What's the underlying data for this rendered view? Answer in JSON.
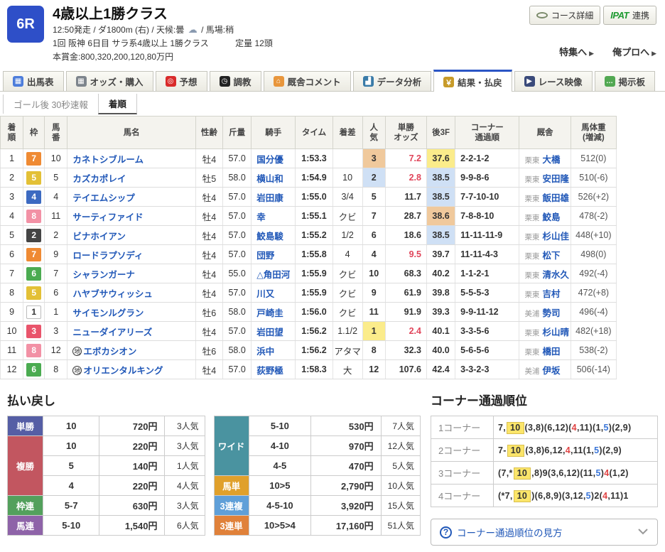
{
  "header": {
    "race_number": "6R",
    "title": "4歳以上1勝クラス",
    "meta1_left": "12:50発走 / ダ1800m (右) / 天候:曇",
    "weather_glyph": "☁",
    "meta1_right": "/ 馬場:稍",
    "meta2_left": "1回 阪神 6日目 サラ系4歳以上 1勝クラス",
    "meta2_right": "定量 12頭",
    "meta3": "本賞金:800,320,200,120,80万円",
    "course_button": "コース詳細",
    "ipat_logo": "IPAT",
    "ipat_button": "連携",
    "links": [
      {
        "label": "特集へ",
        "arrow": "▶"
      },
      {
        "label": "俺プロへ",
        "arrow": "▶"
      }
    ]
  },
  "tabs": [
    {
      "label": "出馬表",
      "icon": "entry-table",
      "glyph": "▦",
      "color": "#4d7ddb",
      "active": false
    },
    {
      "label": "オッズ・購入",
      "icon": "odds-purchase",
      "glyph": "▦",
      "color": "#7d848c",
      "active": false
    },
    {
      "label": "予想",
      "icon": "prediction-target",
      "glyph": "◎",
      "color": "#d92b2b",
      "active": false
    },
    {
      "label": "調教",
      "icon": "training-stopwatch",
      "glyph": "◷",
      "color": "#222222",
      "active": false
    },
    {
      "label": "厩舎コメント",
      "icon": "stable-comment",
      "glyph": "⌂",
      "color": "#e8963c",
      "active": false
    },
    {
      "label": "データ分析",
      "icon": "data-analysis",
      "glyph": "▟",
      "color": "#3a7ba8",
      "active": false
    },
    {
      "label": "結果・払戻",
      "icon": "result-payout",
      "glyph": "￥",
      "color": "#c79b2a",
      "active": true
    },
    {
      "label": "レース映像",
      "icon": "race-video",
      "glyph": "▶",
      "color": "#3a4a7a",
      "active": false
    },
    {
      "label": "掲示板",
      "icon": "bbs-chat",
      "glyph": "…",
      "color": "#52a852",
      "active": false
    }
  ],
  "subtabs": [
    {
      "label": "ゴール後 30秒速報",
      "active": false
    },
    {
      "label": "着順",
      "active": true
    }
  ],
  "results": {
    "columns": [
      "着\n順",
      "枠",
      "馬\n番",
      "馬名",
      "性齢",
      "斤量",
      "騎手",
      "タイム",
      "着差",
      "人\n気",
      "単勝\nオッズ",
      "後3F",
      "コーナー\n通過順",
      "厩舎",
      "馬体重\n(増減)"
    ],
    "waku_colors": {
      "1": "#ffffff",
      "2": "#444444",
      "3": "#e9546b",
      "4": "#3c6ac1",
      "5": "#e3c036",
      "6": "#4bab51",
      "7": "#ef8a33",
      "8": "#f291a5"
    },
    "rows": [
      {
        "rank": "1",
        "waku": "7",
        "num": "10",
        "mark": "",
        "name": "カネトシブルーム",
        "sexage": "牡4",
        "load": "57.0",
        "jockey": "国分優",
        "time": "1:53.3",
        "margin": "",
        "pop": "3",
        "pop_hl": 3,
        "odds": "7.2",
        "odds_red": true,
        "l3f": "37.6",
        "l3f_hl": 1,
        "corner": "2-2-1-2",
        "region": "栗東",
        "trainer": "大橋",
        "weight": "512(0)"
      },
      {
        "rank": "2",
        "waku": "5",
        "num": "5",
        "mark": "",
        "name": "カズカポレイ",
        "sexage": "牡5",
        "load": "58.0",
        "jockey": "横山和",
        "time": "1:54.9",
        "margin": "10",
        "pop": "2",
        "pop_hl": 2,
        "odds": "2.8",
        "odds_red": true,
        "l3f": "38.5",
        "l3f_hl": 2,
        "corner": "9-9-8-6",
        "region": "栗東",
        "trainer": "安田隆",
        "weight": "510(-6)"
      },
      {
        "rank": "3",
        "waku": "4",
        "num": "4",
        "mark": "",
        "name": "テイエムシップ",
        "sexage": "牡4",
        "load": "57.0",
        "jockey": "岩田康",
        "time": "1:55.0",
        "margin": "3/4",
        "pop": "5",
        "pop_hl": 0,
        "odds": "11.7",
        "odds_red": false,
        "l3f": "38.5",
        "l3f_hl": 2,
        "corner": "7-7-10-10",
        "region": "栗東",
        "trainer": "飯田雄",
        "weight": "526(+2)"
      },
      {
        "rank": "4",
        "waku": "8",
        "num": "11",
        "mark": "",
        "name": "サーティファイド",
        "sexage": "牡4",
        "load": "57.0",
        "jockey": "幸",
        "time": "1:55.1",
        "margin": "クビ",
        "pop": "7",
        "pop_hl": 0,
        "odds": "28.7",
        "odds_red": false,
        "l3f": "38.6",
        "l3f_hl": 3,
        "corner": "7-8-8-10",
        "region": "栗東",
        "trainer": "鮫島",
        "weight": "478(-2)"
      },
      {
        "rank": "5",
        "waku": "2",
        "num": "2",
        "mark": "",
        "name": "ビナホイアン",
        "sexage": "牡4",
        "load": "57.0",
        "jockey": "鮫島駿",
        "time": "1:55.2",
        "margin": "1/2",
        "pop": "6",
        "pop_hl": 0,
        "odds": "18.6",
        "odds_red": false,
        "l3f": "38.5",
        "l3f_hl": 2,
        "corner": "11-11-11-9",
        "region": "栗東",
        "trainer": "杉山佳",
        "weight": "448(+10)"
      },
      {
        "rank": "6",
        "waku": "7",
        "num": "9",
        "mark": "",
        "name": "ロードラプソディ",
        "sexage": "牡4",
        "load": "57.0",
        "jockey": "団野",
        "time": "1:55.8",
        "margin": "4",
        "pop": "4",
        "pop_hl": 0,
        "odds": "9.5",
        "odds_red": true,
        "l3f": "39.7",
        "l3f_hl": 0,
        "corner": "11-11-4-3",
        "region": "栗東",
        "trainer": "松下",
        "weight": "498(0)"
      },
      {
        "rank": "7",
        "waku": "6",
        "num": "7",
        "mark": "",
        "name": "シャランガーナ",
        "sexage": "牡4",
        "load": "55.0",
        "jockey": "△角田河",
        "time": "1:55.9",
        "margin": "クビ",
        "pop": "10",
        "pop_hl": 0,
        "odds": "68.3",
        "odds_red": false,
        "l3f": "40.2",
        "l3f_hl": 0,
        "corner": "1-1-2-1",
        "region": "栗東",
        "trainer": "清水久",
        "weight": "492(-4)"
      },
      {
        "rank": "8",
        "waku": "5",
        "num": "6",
        "mark": "",
        "name": "ハヤブサウィッシュ",
        "sexage": "牡4",
        "load": "57.0",
        "jockey": "川又",
        "time": "1:55.9",
        "margin": "クビ",
        "pop": "9",
        "pop_hl": 0,
        "odds": "61.9",
        "odds_red": false,
        "l3f": "39.8",
        "l3f_hl": 0,
        "corner": "5-5-5-3",
        "region": "栗東",
        "trainer": "吉村",
        "weight": "472(+8)"
      },
      {
        "rank": "9",
        "waku": "1",
        "num": "1",
        "mark": "",
        "name": "サイモンルグラン",
        "sexage": "牡6",
        "load": "58.0",
        "jockey": "戸崎圭",
        "time": "1:56.0",
        "margin": "クビ",
        "pop": "11",
        "pop_hl": 0,
        "odds": "91.9",
        "odds_red": false,
        "l3f": "39.3",
        "l3f_hl": 0,
        "corner": "9-9-11-12",
        "region": "美浦",
        "trainer": "勢司",
        "weight": "496(-4)"
      },
      {
        "rank": "10",
        "waku": "3",
        "num": "3",
        "mark": "",
        "name": "ニューダイアリーズ",
        "sexage": "牡4",
        "load": "57.0",
        "jockey": "岩田望",
        "time": "1:56.2",
        "margin": "1.1/2",
        "pop": "1",
        "pop_hl": 1,
        "odds": "2.4",
        "odds_red": true,
        "l3f": "40.1",
        "l3f_hl": 0,
        "corner": "3-3-5-6",
        "region": "栗東",
        "trainer": "杉山晴",
        "weight": "482(+18)"
      },
      {
        "rank": "11",
        "waku": "8",
        "num": "12",
        "mark": "地",
        "name": "エボカシオン",
        "sexage": "牡6",
        "load": "58.0",
        "jockey": "浜中",
        "time": "1:56.2",
        "margin": "アタマ",
        "pop": "8",
        "pop_hl": 0,
        "odds": "32.3",
        "odds_red": false,
        "l3f": "40.0",
        "l3f_hl": 0,
        "corner": "5-6-5-6",
        "region": "栗東",
        "trainer": "橋田",
        "weight": "538(-2)"
      },
      {
        "rank": "12",
        "waku": "6",
        "num": "8",
        "mark": "地",
        "name": "オリエンタルキング",
        "sexage": "牡4",
        "load": "57.0",
        "jockey": "荻野極",
        "time": "1:58.3",
        "margin": "大",
        "pop": "12",
        "pop_hl": 0,
        "odds": "107.6",
        "odds_red": false,
        "l3f": "42.4",
        "l3f_hl": 0,
        "corner": "3-3-2-3",
        "region": "美浦",
        "trainer": "伊坂",
        "weight": "506(-14)"
      }
    ]
  },
  "payout": {
    "title": "払い戻し",
    "table1": [
      {
        "label": "単勝",
        "color": "#555ea5",
        "rows": [
          {
            "combo": "10",
            "amount": "720円",
            "pop": "3人気"
          }
        ]
      },
      {
        "label": "複勝",
        "color": "#c25660",
        "rows": [
          {
            "combo": "10",
            "amount": "220円",
            "pop": "3人気"
          },
          {
            "combo": "5",
            "amount": "140円",
            "pop": "1人気"
          },
          {
            "combo": "4",
            "amount": "220円",
            "pop": "4人気"
          }
        ]
      },
      {
        "label": "枠連",
        "color": "#53a05c",
        "rows": [
          {
            "combo": "5-7",
            "amount": "630円",
            "pop": "3人気"
          }
        ]
      },
      {
        "label": "馬連",
        "color": "#8e63a8",
        "rows": [
          {
            "combo": "5-10",
            "amount": "1,540円",
            "pop": "6人気"
          }
        ]
      }
    ],
    "table2": [
      {
        "label": "ワイド",
        "color": "#4a93a0",
        "rows": [
          {
            "combo": "5-10",
            "amount": "530円",
            "pop": "7人気"
          },
          {
            "combo": "4-10",
            "amount": "970円",
            "pop": "12人気"
          },
          {
            "combo": "4-5",
            "amount": "470円",
            "pop": "5人気"
          }
        ]
      },
      {
        "label": "馬単",
        "color": "#e0a02b",
        "rows": [
          {
            "combo": "10>5",
            "amount": "2,790円",
            "pop": "10人気"
          }
        ]
      },
      {
        "label": "3連複",
        "color": "#5f9fd8",
        "rows": [
          {
            "combo": "4-5-10",
            "amount": "3,920円",
            "pop": "15人気"
          }
        ]
      },
      {
        "label": "3連単",
        "color": "#e0813a",
        "rows": [
          {
            "combo": "10>5>4",
            "amount": "17,160円",
            "pop": "51人気"
          }
        ]
      }
    ]
  },
  "corners": {
    "title": "コーナー通過順位",
    "rows": [
      {
        "label": "1コーナー",
        "segments": [
          [
            "7,",
            "n"
          ],
          [
            "10",
            "w"
          ],
          [
            "(3,8)(6,12)(",
            "n"
          ],
          [
            "4",
            "t"
          ],
          [
            ",11)(1,",
            "n"
          ],
          [
            "5",
            "s"
          ],
          [
            ")(2,9)",
            "n"
          ]
        ]
      },
      {
        "label": "2コーナー",
        "segments": [
          [
            "7-",
            "n"
          ],
          [
            "10",
            "w"
          ],
          [
            "(3,8)6,12,",
            "n"
          ],
          [
            "4",
            "t"
          ],
          [
            ",11(1,",
            "n"
          ],
          [
            "5",
            "s"
          ],
          [
            ")(2,9)",
            "n"
          ]
        ]
      },
      {
        "label": "3コーナー",
        "segments": [
          [
            "(7,*",
            "n"
          ],
          [
            "10",
            "w"
          ],
          [
            ",8)9(3,6,12)(11,",
            "n"
          ],
          [
            "5",
            "s"
          ],
          [
            ")",
            "n"
          ],
          [
            "4",
            "t"
          ],
          [
            "(1,2)",
            "n"
          ]
        ]
      },
      {
        "label": "4コーナー",
        "segments": [
          [
            "(*7,",
            "n"
          ],
          [
            "10",
            "w"
          ],
          [
            ")(6,8,9)(3,12,",
            "n"
          ],
          [
            "5",
            "s"
          ],
          [
            ")2(",
            "n"
          ],
          [
            "4",
            "t"
          ],
          [
            ",11)1",
            "n"
          ]
        ]
      }
    ],
    "help": {
      "q": "?",
      "label": "コーナー通過順位の見方"
    }
  }
}
